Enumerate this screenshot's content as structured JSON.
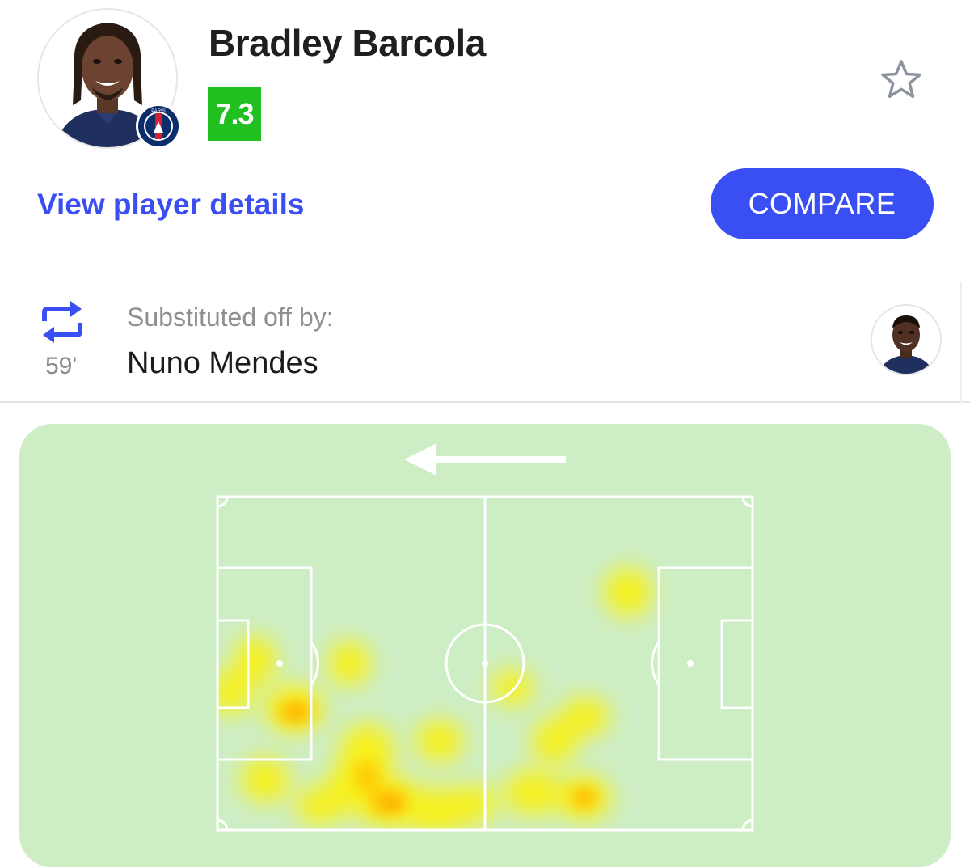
{
  "player": {
    "name": "Bradley Barcola",
    "rating": "7.3",
    "club_badge_text": "PARIS"
  },
  "actions": {
    "details_link": "View player details",
    "compare_button": "COMPARE"
  },
  "substitution": {
    "minute": "59'",
    "label": "Substituted off by:",
    "player_name": "Nuno Mendes"
  },
  "heatmap": {
    "attack_direction": "left"
  },
  "colors": {
    "accent": "#3a4ff3",
    "rating_bg": "#1fc01f",
    "pitch_bg": "#cdedc4",
    "heat_low": "#fff200",
    "heat_high": "#ff8a00"
  },
  "icons": {
    "favorite": "star-outline-icon",
    "substitution": "swap-arrows-icon",
    "direction": "arrow-left-icon"
  }
}
